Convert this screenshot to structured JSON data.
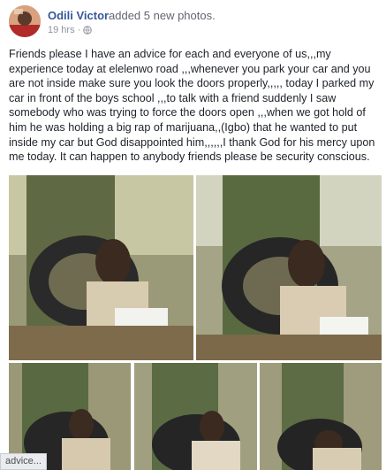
{
  "post": {
    "author": "Odili Victor",
    "action": "added 5 new photos.",
    "time": "19 hrs",
    "separator": "·",
    "privacy_icon": "globe-icon",
    "text": "Friends please I have an advice for each and everyone of us,,,my experience today at elelenwo road ,,,whenever you park your car and you are not inside make sure you look the doors properly,,,,, today I parked my car in front of the boys school ,,,to talk with a friend suddenly I saw somebody who was trying to force the doors open ,,,when we got hold of him he was holding a big rap of marijuana,,(Igbo) that he wanted to put inside my car but God disappointed him,,,,,,I thank God for his mercy upon me today. It can happen to anybody friends please be security conscious."
  },
  "photos": [
    {
      "subject": "man-tied-to-tree-photo"
    },
    {
      "subject": "man-tied-to-tree-photo"
    },
    {
      "subject": "man-tied-to-tree-photo"
    },
    {
      "subject": "man-tied-to-tree-photo"
    },
    {
      "subject": "man-tied-to-tree-photo"
    }
  ],
  "status_tooltip": "advice...",
  "colors": {
    "link": "#365899",
    "secondary_text": "#90949c",
    "body_text": "#1d2129"
  }
}
